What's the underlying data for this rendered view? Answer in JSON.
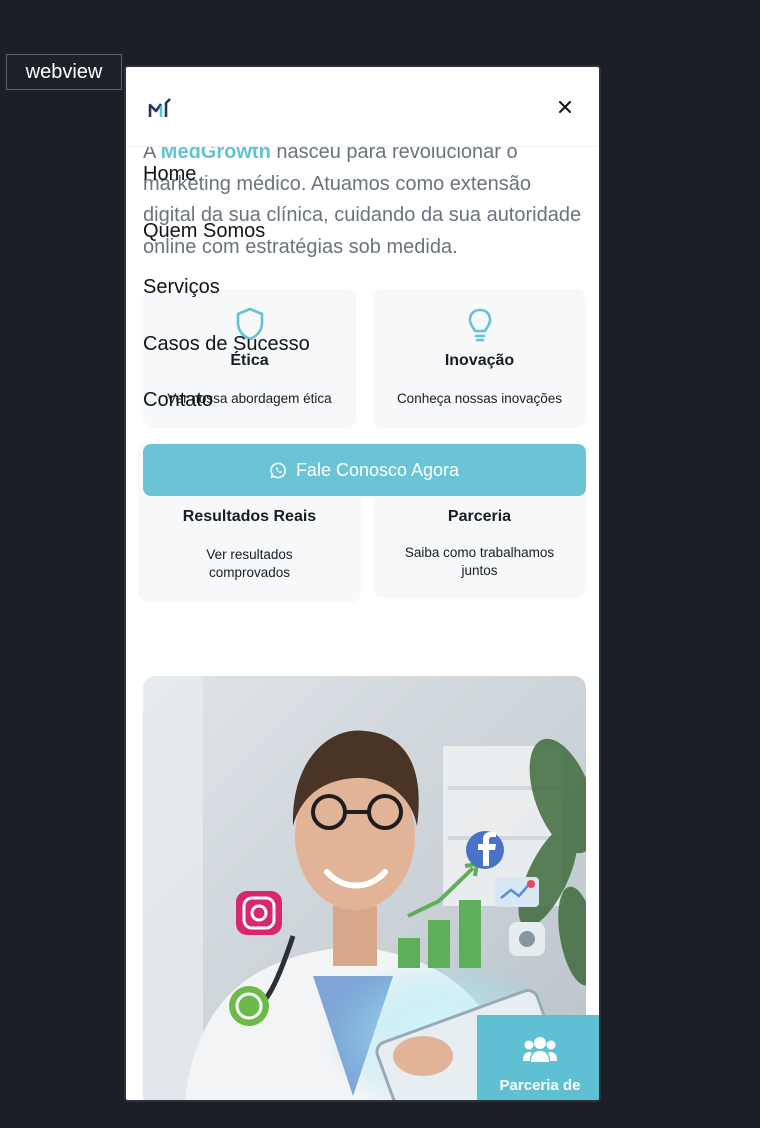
{
  "window": {
    "label": "webview"
  },
  "intro": {
    "prefix": "A ",
    "brand": "MedGrowth",
    "suffix": " nasceu para revolucionar o marketing médico. Atuamos como extensão digital da sua clínica, cuidando da sua autoridade online com estratégias sob medida."
  },
  "menu": {
    "items": [
      {
        "label": "Home"
      },
      {
        "label": "Quem Somos"
      },
      {
        "label": "Serviços"
      },
      {
        "label": "Casos de Sucesso"
      },
      {
        "label": "Contato"
      }
    ]
  },
  "cards": [
    {
      "title": "Ética",
      "desc": "Ver nossa abordagem ética",
      "icon": "shield-icon"
    },
    {
      "title": "Inovação",
      "desc": "Conheça nossas inovações",
      "icon": "lightbulb-icon"
    },
    {
      "title": "Resultados Reais",
      "desc": "Ver resultados comprovados",
      "icon": "chart-icon"
    },
    {
      "title": "Parceria",
      "desc": "Saiba como trabalhamos juntos",
      "icon": "handshake-icon"
    }
  ],
  "cta": {
    "label": "Fale Conosco Agora",
    "icon": "whatsapp-icon"
  },
  "badge": {
    "label": "Parceria de",
    "icon": "users-icon"
  },
  "colors": {
    "accent": "#63c2d4",
    "cta": "#6ac4d6",
    "text": "#111418",
    "muted": "#6b7380"
  }
}
